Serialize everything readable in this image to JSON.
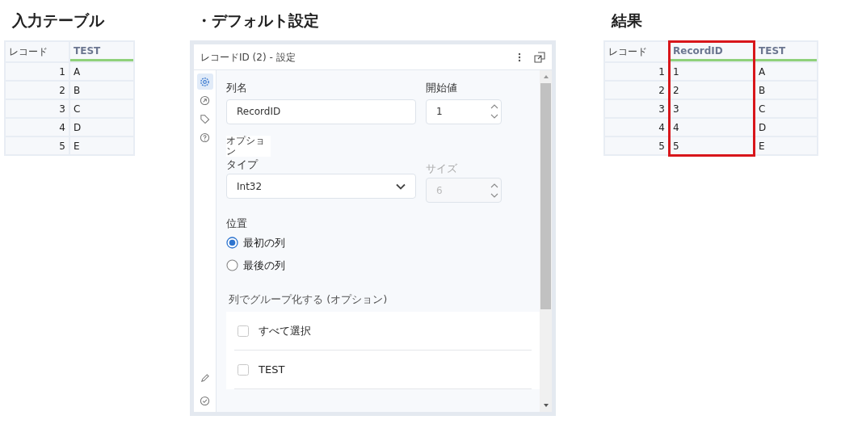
{
  "input_table": {
    "heading": "入力テーブル",
    "columns": [
      {
        "label": "レコード",
        "kind": "record",
        "highlighted": false
      },
      {
        "label": "TEST",
        "kind": "field",
        "highlighted": false
      }
    ],
    "rows": [
      [
        "1",
        "A"
      ],
      [
        "2",
        "B"
      ],
      [
        "3",
        "C"
      ],
      [
        "4",
        "D"
      ],
      [
        "5",
        "E"
      ]
    ]
  },
  "settings": {
    "heading": "・デフォルト設定",
    "panel": {
      "title": "レコードID (2) - 設定",
      "side_tabs": [
        {
          "kind": "gear",
          "selected": true
        },
        {
          "kind": "arrow",
          "selected": false
        },
        {
          "kind": "tag",
          "selected": false
        },
        {
          "kind": "help",
          "selected": false
        }
      ],
      "bottom_tabs": [
        {
          "kind": "pencil",
          "selected": false
        },
        {
          "kind": "check",
          "selected": false
        }
      ],
      "column_name": {
        "label": "列名",
        "value": "RecordID"
      },
      "start_value": {
        "label": "開始値",
        "value": "1"
      },
      "options_label": "オプション",
      "type": {
        "label": "タイプ",
        "value": "Int32"
      },
      "size": {
        "label": "サイズ",
        "value": "6",
        "disabled": true
      },
      "position": {
        "label": "位置",
        "options": [
          {
            "label": "最初の列",
            "selected": true
          },
          {
            "label": "最後の列",
            "selected": false
          }
        ]
      },
      "group_by": {
        "label": "列でグループ化する (オプション)",
        "items": [
          {
            "label": "すべて選択",
            "checked": false
          },
          {
            "label": "TEST",
            "checked": false
          }
        ]
      }
    }
  },
  "result_table": {
    "heading": "結果",
    "columns": [
      {
        "label": "レコード",
        "kind": "record",
        "highlighted": false
      },
      {
        "label": "RecordID",
        "kind": "field",
        "highlighted": true
      },
      {
        "label": "TEST",
        "kind": "field",
        "highlighted": false
      }
    ],
    "rows": [
      [
        "1",
        "1",
        "A"
      ],
      [
        "2",
        "2",
        "B"
      ],
      [
        "3",
        "3",
        "C"
      ],
      [
        "4",
        "4",
        "D"
      ],
      [
        "5",
        "5",
        "E"
      ]
    ]
  }
}
